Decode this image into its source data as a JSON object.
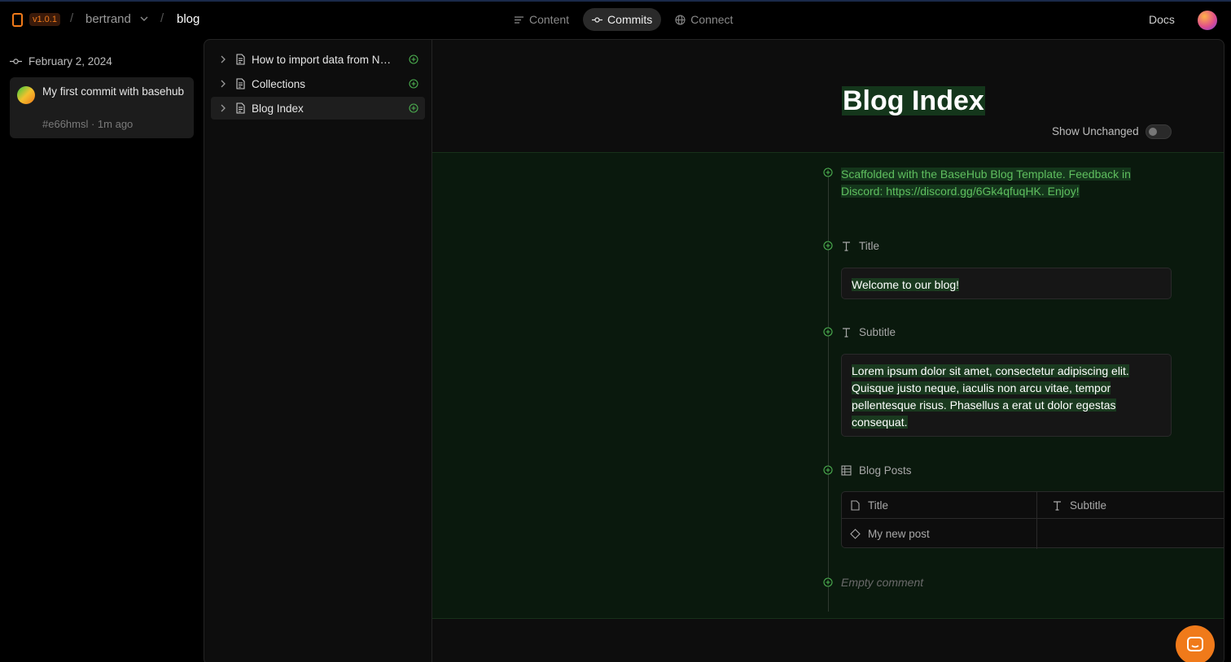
{
  "header": {
    "version": "v1.0.1",
    "sep": "/",
    "workspace": "bertrand",
    "repo": "blog",
    "nav": [
      {
        "label": "Content",
        "icon": "list-icon",
        "active": false
      },
      {
        "label": "Commits",
        "icon": "commit-icon",
        "active": true
      },
      {
        "label": "Connect",
        "icon": "globe-icon",
        "active": false
      }
    ],
    "docs": "Docs"
  },
  "commits": {
    "date": "February 2, 2024",
    "items": [
      {
        "message": "My first commit with basehub",
        "meta": "#e66hmsl · 1m ago"
      }
    ]
  },
  "tree": {
    "items": [
      {
        "label": "How to import data from Notion",
        "active": false
      },
      {
        "label": "Collections",
        "active": false
      },
      {
        "label": "Blog Index",
        "active": true
      }
    ]
  },
  "main": {
    "title": "Blog Index",
    "show_unchanged": "Show Unchanged",
    "description": "Scaffolded with the BaseHub Blog Template. Feedback in Discord: https://discord.gg/6Gk4qfuqHK. Enjoy!",
    "fields": {
      "title_label": "Title",
      "title_value": "Welcome to our blog!",
      "subtitle_label": "Subtitle",
      "subtitle_value": "Lorem ipsum dolor sit amet, consectetur adipiscing elit. Quisque justo neque, iaculis non arcu vitae, tempor pellentesque risus. Phasellus a erat ut dolor egestas consequat.",
      "posts_label": "Blog Posts"
    },
    "table": {
      "columns": [
        "Title",
        "Subtitle"
      ],
      "rows": [
        [
          "My new post",
          ""
        ]
      ]
    },
    "empty_comment": "Empty comment"
  },
  "colors": {
    "accent": "#f07a1a",
    "added_green": "#5fbf5f",
    "added_bg": "#0a190d"
  }
}
